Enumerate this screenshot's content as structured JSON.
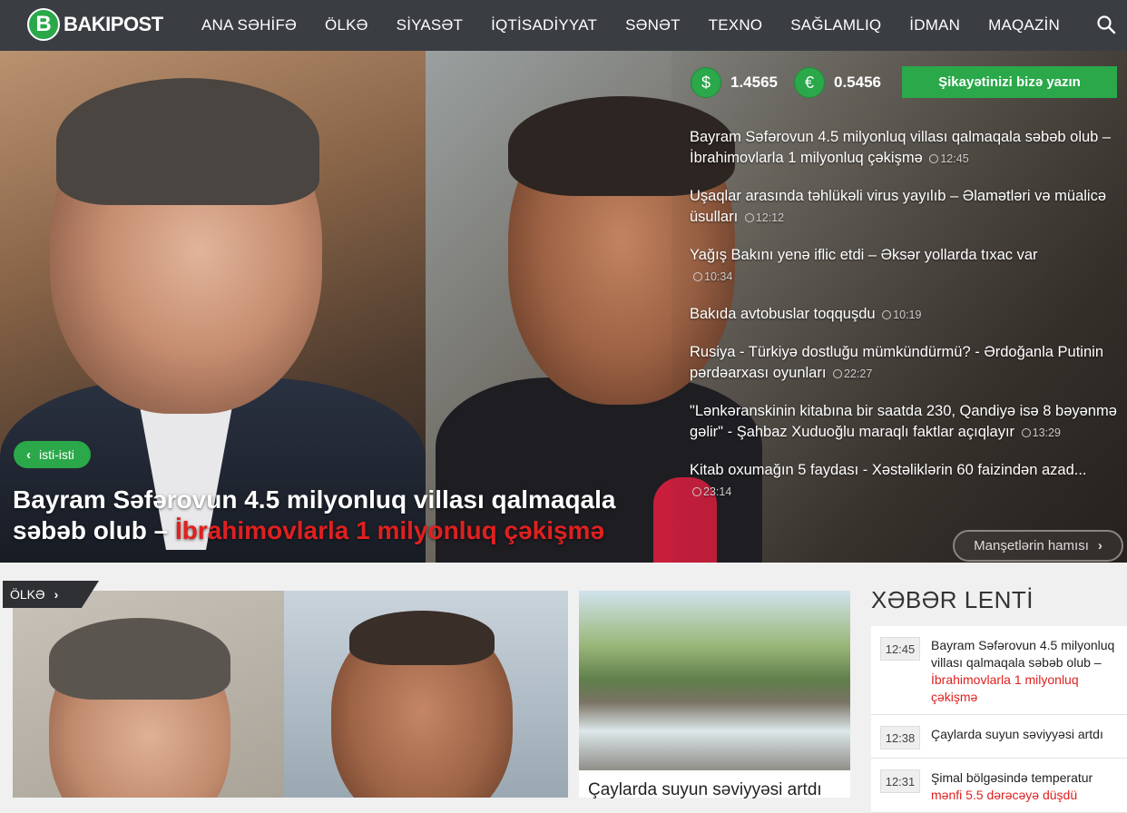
{
  "brand": {
    "logo_letter": "B",
    "name": "BAKIPOST",
    "accent": "#2aa84a"
  },
  "nav": {
    "items": [
      "ANA SƏHİFƏ",
      "ÖLKƏ",
      "SİYASƏT",
      "İQTİSADİYYAT",
      "SƏNƏT",
      "TEXNO",
      "SAĞLAMLIQ",
      "İDMAN",
      "MAQAZİN"
    ],
    "search_icon": "search-icon"
  },
  "hero": {
    "tag": "isti-isti",
    "title_main": "Bayram Səfərovun 4.5 milyonluq villası qalmaqala səbəb olub – ",
    "title_red": "İbrahimovlarla 1 milyonluq çəkişmə"
  },
  "rates": {
    "usd_symbol": "$",
    "usd_value": "1.4565",
    "eur_symbol": "€",
    "eur_value": "0.5456"
  },
  "complaint_button": "Şikayətinizi bizə yazın",
  "headlines": [
    {
      "text": "Bayram Səfərovun 4.5 milyonluq villası qalmaqala səbəb olub – İbrahimovlarla 1 milyonluq çəkişmə",
      "time": "12:45"
    },
    {
      "text": "Uşaqlar arasında təhlükəli virus yayılıb – Əlamətləri və müalicə üsulları",
      "time": "12:12"
    },
    {
      "text": "Yağış Bakını yenə iflic etdi – Əksər yollarda tıxac var",
      "time": "10:34"
    },
    {
      "text": "Bakıda avtobuslar toqquşdu",
      "time": "10:19"
    },
    {
      "text": "Rusiya - Türkiyə dostluğu mümkündürmü? - Ərdoğanla Putinin pərdəarxası oyunları",
      "time": "22:27"
    },
    {
      "text": "\"Lənkəranskinin kitabına bir saatda 230, Qandiyə isə 8 bəyənmə gəlir\" - Şahbaz Xuduoğlu maraqlı faktlar açıqlayır",
      "time": "13:29"
    },
    {
      "text": "Kitab oxumağın 5 faydası - Xəstəliklərin 60 faizindən azad...",
      "time": "23:14"
    }
  ],
  "more_button": "Manşetlərin hamısı",
  "section": {
    "tag": "ÖLKƏ"
  },
  "side_card": {
    "title": "Çaylarda suyun səviyyəsi artdı"
  },
  "feed": {
    "title": "XƏBƏR LENTİ",
    "items": [
      {
        "time": "12:45",
        "text": "Bayram Səfərovun 4.5 milyonluq villası qalmaqala səbəb olub – ",
        "red": "İbrahimovlarla 1 milyonluq çəkişmə"
      },
      {
        "time": "12:38",
        "text": "Çaylarda suyun səviyyəsi artdı",
        "red": ""
      },
      {
        "time": "12:31",
        "text": "Şimal bölgəsində temperatur ",
        "red": "mənfi 5.5 dərəcəyə düşdü"
      }
    ]
  }
}
